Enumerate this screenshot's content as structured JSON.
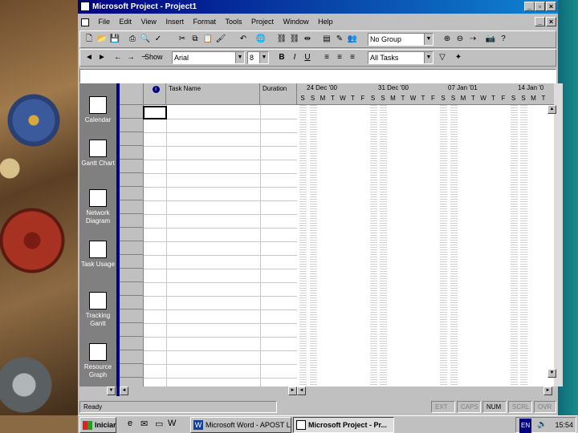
{
  "window": {
    "title": "Microsoft Project - Project1"
  },
  "menu": [
    "File",
    "Edit",
    "View",
    "Insert",
    "Format",
    "Tools",
    "Project",
    "Window",
    "Help"
  ],
  "toolbar": {
    "group_select": "No Group",
    "show_label": "Show",
    "font": "Arial",
    "size": "8",
    "filter": "All Tasks"
  },
  "views": [
    {
      "label": "Calendar",
      "icon": "calendar-icon"
    },
    {
      "label": "Gantt Chart",
      "icon": "gantt-chart-icon"
    },
    {
      "label": "Network Diagram",
      "icon": "network-diagram-icon"
    },
    {
      "label": "Task Usage",
      "icon": "task-usage-icon"
    },
    {
      "label": "Tracking Gantt",
      "icon": "tracking-gantt-icon"
    },
    {
      "label": "Resource Graph",
      "icon": "resource-graph-icon"
    }
  ],
  "table": {
    "indicator_header": "info-icon",
    "task_name_header": "Task Name",
    "duration_header": "Duration"
  },
  "gantt": {
    "weeks": [
      "24 Dec '00",
      "31 Dec '00",
      "07 Jan '01",
      "14 Jan '0"
    ],
    "days": [
      "S",
      "S",
      "M",
      "T",
      "W",
      "T",
      "F",
      "S",
      "S",
      "M",
      "T",
      "W",
      "T",
      "F",
      "S",
      "S",
      "M",
      "T",
      "W",
      "T",
      "F",
      "S",
      "S",
      "M",
      "T"
    ]
  },
  "status": {
    "text": "Ready",
    "indicators": [
      "EXT",
      "CAPS",
      "NUM",
      "SCRL",
      "OVR"
    ]
  },
  "taskbar": {
    "start": "Iniciar",
    "tasks": [
      "Microsoft Word - APOST L...",
      "Microsoft Project - Pr..."
    ],
    "time": "15:54",
    "lang": "EN"
  }
}
